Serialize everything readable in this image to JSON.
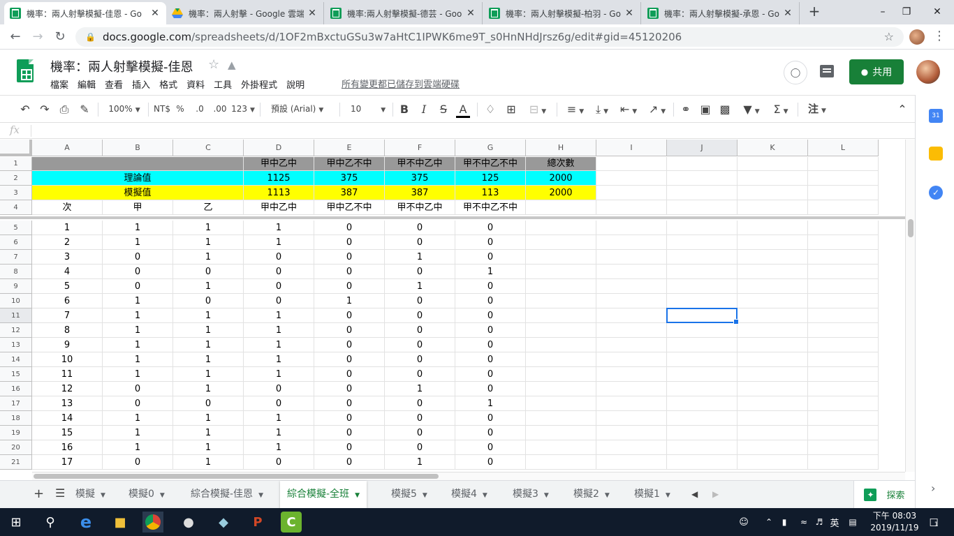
{
  "browser": {
    "tabs": [
      {
        "title": "機率：兩人射擊模擬-佳恩 - Go",
        "icon": "sheets",
        "active": true
      },
      {
        "title": "機率：兩人射擊 - Google 雲端",
        "icon": "drive",
        "active": false
      },
      {
        "title": "機率:兩人射擊模擬-德芸 - Goo",
        "icon": "sheets",
        "active": false
      },
      {
        "title": "機率：兩人射擊模擬-柏羽 - Go",
        "icon": "sheets",
        "active": false
      },
      {
        "title": "機率：兩人射擊模擬-承恩 - Go",
        "icon": "sheets",
        "active": false
      }
    ],
    "url_host": "docs.google.com",
    "url_path": "/spreadsheets/d/1OF2mBxctuGSu3w7aHtC1IPWK6me9T_s0HnNHdJrsz6g/edit#gid=45120206"
  },
  "doc": {
    "title": "機率：兩人射擊模擬-佳恩",
    "menus": [
      "檔案",
      "編輯",
      "查看",
      "插入",
      "格式",
      "資料",
      "工具",
      "外掛程式",
      "說明"
    ],
    "save_status": "所有變更都已儲存到雲端硬碟",
    "share_label": "共用"
  },
  "toolbar": {
    "zoom": "100%",
    "currency": "NT$",
    "percent": "%",
    "dec_decrease": ".0",
    "dec_increase": ".00",
    "number_format": "123",
    "font": "預設 (Arial)",
    "font_size": "10",
    "input_tools": "注"
  },
  "formula_bar": {
    "fx": "fx",
    "value": ""
  },
  "grid": {
    "columns": [
      "A",
      "B",
      "C",
      "D",
      "E",
      "F",
      "G",
      "H",
      "I",
      "J",
      "K",
      "L"
    ],
    "selected_column": "J",
    "selected_row": "11",
    "row_numbers": [
      "1",
      "2",
      "3",
      "4",
      "5",
      "6",
      "7",
      "8",
      "9",
      "10",
      "11",
      "12",
      "13",
      "14",
      "15",
      "16",
      "17",
      "18",
      "19",
      "20",
      "21"
    ],
    "header_row": [
      "",
      "",
      "",
      "甲中乙中",
      "甲中乙不中",
      "甲不中乙中",
      "甲不中乙不中",
      "總次數"
    ],
    "theory": {
      "label": "理論值",
      "values": [
        "1125",
        "375",
        "375",
        "125",
        "2000"
      ]
    },
    "simulated": {
      "label": "模擬值",
      "values": [
        "1113",
        "387",
        "387",
        "113",
        "2000"
      ]
    },
    "column_labels": [
      "次",
      "甲",
      "乙",
      "甲中乙中",
      "甲中乙不中",
      "甲不中乙中",
      "甲不中乙不中"
    ],
    "data_rows": [
      [
        "1",
        "1",
        "1",
        "1",
        "0",
        "0",
        "0"
      ],
      [
        "2",
        "1",
        "1",
        "1",
        "0",
        "0",
        "0"
      ],
      [
        "3",
        "0",
        "1",
        "0",
        "0",
        "1",
        "0"
      ],
      [
        "4",
        "0",
        "0",
        "0",
        "0",
        "0",
        "1"
      ],
      [
        "5",
        "0",
        "1",
        "0",
        "0",
        "1",
        "0"
      ],
      [
        "6",
        "1",
        "0",
        "0",
        "1",
        "0",
        "0"
      ],
      [
        "7",
        "1",
        "1",
        "1",
        "0",
        "0",
        "0"
      ],
      [
        "8",
        "1",
        "1",
        "1",
        "0",
        "0",
        "0"
      ],
      [
        "9",
        "1",
        "1",
        "1",
        "0",
        "0",
        "0"
      ],
      [
        "10",
        "1",
        "1",
        "1",
        "0",
        "0",
        "0"
      ],
      [
        "11",
        "1",
        "1",
        "1",
        "0",
        "0",
        "0"
      ],
      [
        "12",
        "0",
        "1",
        "0",
        "0",
        "1",
        "0"
      ],
      [
        "13",
        "0",
        "0",
        "0",
        "0",
        "0",
        "1"
      ],
      [
        "14",
        "1",
        "1",
        "1",
        "0",
        "0",
        "0"
      ],
      [
        "15",
        "1",
        "1",
        "1",
        "0",
        "0",
        "0"
      ],
      [
        "16",
        "1",
        "1",
        "1",
        "0",
        "0",
        "0"
      ],
      [
        "17",
        "0",
        "1",
        "0",
        "0",
        "1",
        "0"
      ]
    ],
    "colors": {
      "gray": "#999999",
      "cyan": "#00ffff",
      "yellow": "#ffff00"
    }
  },
  "sheets": {
    "tabs": [
      {
        "label": "模擬",
        "active": false
      },
      {
        "label": "模擬0",
        "active": false
      },
      {
        "label": "綜合模擬-佳恩",
        "active": false
      },
      {
        "label": "綜合模擬-全班",
        "active": true
      },
      {
        "label": "模擬5",
        "active": false
      },
      {
        "label": "模擬4",
        "active": false
      },
      {
        "label": "模擬3",
        "active": false
      },
      {
        "label": "模擬2",
        "active": false
      },
      {
        "label": "模擬1",
        "active": false
      }
    ],
    "explore_label": "探索"
  },
  "taskbar": {
    "ime": "英",
    "time": "下午 08:03",
    "date": "2019/11/19",
    "notifications": "1"
  }
}
